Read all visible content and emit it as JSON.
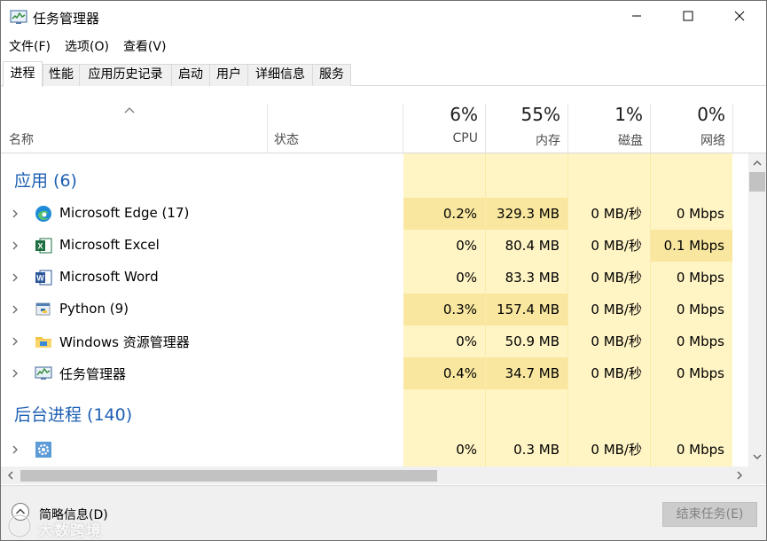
{
  "window": {
    "title": "任务管理器",
    "controls": {
      "minimize": "minimize-icon",
      "maximize": "maximize-icon",
      "close": "close-icon"
    }
  },
  "menu": [
    "文件(F)",
    "选项(O)",
    "查看(V)"
  ],
  "tabs": [
    {
      "label": "进程",
      "active": true
    },
    {
      "label": "性能"
    },
    {
      "label": "应用历史记录"
    },
    {
      "label": "启动"
    },
    {
      "label": "用户"
    },
    {
      "label": "详细信息"
    },
    {
      "label": "服务"
    }
  ],
  "header": {
    "name_label": "名称",
    "status_label": "状态",
    "columns": [
      {
        "percent": "6%",
        "label": "CPU"
      },
      {
        "percent": "55%",
        "label": "内存"
      },
      {
        "percent": "1%",
        "label": "磁盘"
      },
      {
        "percent": "0%",
        "label": "网络"
      }
    ]
  },
  "groups": {
    "apps": "应用 (6)",
    "background": "后台进程 (140)"
  },
  "rows": [
    {
      "icon": "edge-icon",
      "name": "Microsoft Edge (17)",
      "cpu": "0.2%",
      "memory": "329.3 MB",
      "disk": "0 MB/秒",
      "network": "0 Mbps"
    },
    {
      "icon": "excel-icon",
      "name": "Microsoft Excel",
      "cpu": "0%",
      "memory": "80.4 MB",
      "disk": "0 MB/秒",
      "network": "0.1 Mbps"
    },
    {
      "icon": "word-icon",
      "name": "Microsoft Word",
      "cpu": "0%",
      "memory": "83.3 MB",
      "disk": "0 MB/秒",
      "network": "0 Mbps"
    },
    {
      "icon": "python-icon",
      "name": "Python (9)",
      "cpu": "0.3%",
      "memory": "157.4 MB",
      "disk": "0 MB/秒",
      "network": "0 Mbps"
    },
    {
      "icon": "explorer-folder-icon",
      "name": "Windows 资源管理器",
      "cpu": "0%",
      "memory": "50.9 MB",
      "disk": "0 MB/秒",
      "network": "0 Mbps"
    },
    {
      "icon": "task-manager-icon",
      "name": "任务管理器",
      "cpu": "0.4%",
      "memory": "34.7 MB",
      "disk": "0 MB/秒",
      "network": "0 Mbps"
    }
  ],
  "background_row": {
    "icon": "gear-icon",
    "name": "",
    "cpu": "0%",
    "memory": "0.3 MB",
    "disk": "0 MB/秒",
    "network": "0 Mbps"
  },
  "footer": {
    "fewer_details": "简略信息(D)",
    "end_task": "结束任务(E)",
    "watermark": "大数跨境"
  },
  "colors": {
    "accent": "#1e5fb3",
    "column_bg": "#fff4c4",
    "highlight": "#f9e79f"
  }
}
